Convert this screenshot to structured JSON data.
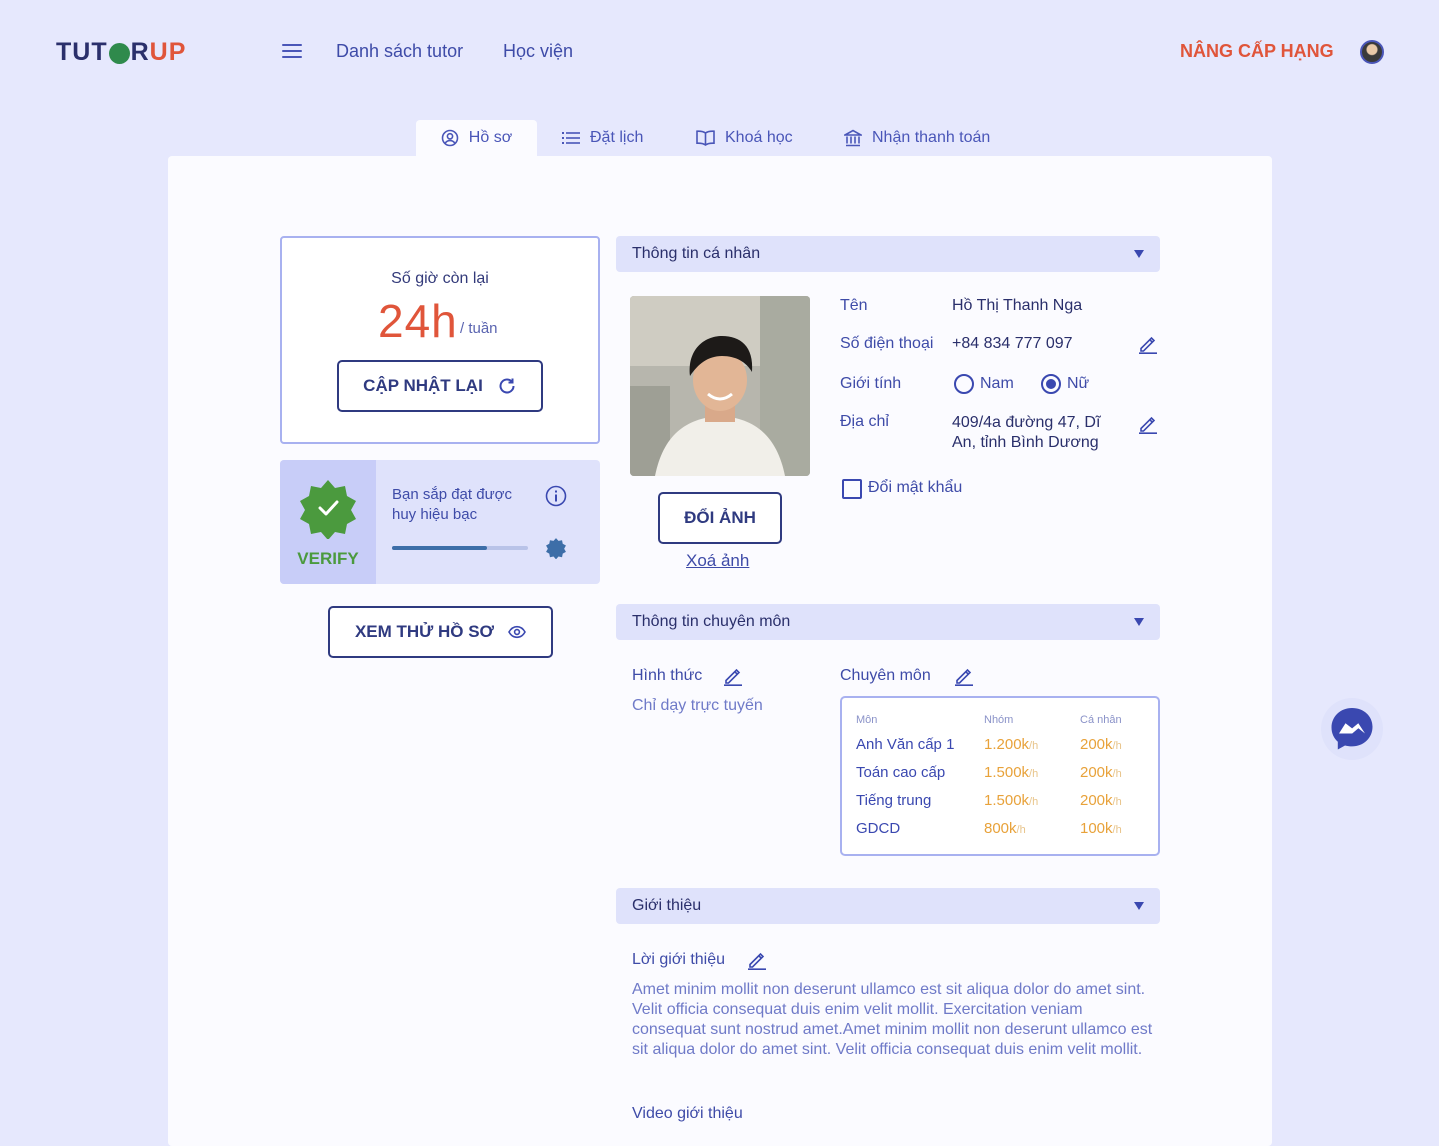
{
  "header": {
    "logo_part1": "TUT",
    "logo_part2": "R ",
    "logo_part3": "UP",
    "nav": [
      "Danh sách tutor",
      "Học viện"
    ],
    "upgrade": "NÂNG CẤP HẠNG"
  },
  "tabs": [
    {
      "label": "Hồ sơ",
      "icon": "user-circle-icon",
      "active": true
    },
    {
      "label": "Đặt lịch",
      "icon": "list-icon",
      "active": false
    },
    {
      "label": "Khoá học",
      "icon": "book-icon",
      "active": false
    },
    {
      "label": "Nhận thanh toán",
      "icon": "bank-icon",
      "active": false
    }
  ],
  "hours": {
    "title": "Số giờ còn lại",
    "value": "24h",
    "unit": "/ tuần",
    "refresh_label": "CẬP NHẬT LẠI"
  },
  "badge": {
    "verify": "VERIFY",
    "text": "Bạn sắp đạt được huy hiệu bạc",
    "progress": 0.7
  },
  "preview_label": "XEM THỬ HỒ SƠ",
  "personal": {
    "section_title": "Thông tin cá nhân",
    "change_photo": "ĐỔI ẢNH",
    "delete_photo": "Xoá ảnh",
    "name_label": "Tên",
    "name_value": "Hồ Thị Thanh Nga",
    "phone_label": "Số điện thoại",
    "phone_value": "+84 834 777 097",
    "gender_label": "Giới tính",
    "gender_options": [
      "Nam",
      "Nữ"
    ],
    "gender_selected": "Nữ",
    "address_label": "Địa chỉ",
    "address_value": "409/4a đường 47, Dĩ An, tỉnh Bình Dương",
    "change_password": "Đổi mật khẩu"
  },
  "professional": {
    "section_title": "Thông tin chuyên môn",
    "format_label": "Hình thức",
    "format_value": "Chỉ dạy trực tuyến",
    "subject_label": "Chuyên môn",
    "columns": [
      "Môn",
      "Nhóm",
      "Cá nhân"
    ],
    "unit": "/h",
    "rows": [
      {
        "subject": "Anh Văn cấp 1",
        "group": "1.200k",
        "personal": "200k"
      },
      {
        "subject": "Toán cao cấp",
        "group": "1.500k",
        "personal": "200k"
      },
      {
        "subject": "Tiếng trung",
        "group": "1.500k",
        "personal": "200k"
      },
      {
        "subject": "GDCD",
        "group": "800k",
        "personal": "100k"
      }
    ]
  },
  "intro": {
    "section_title": "Giới thiệu",
    "label": "Lời giới thiệu",
    "text": "Amet minim mollit non deserunt ullamco est sit aliqua dolor do amet sint. Velit officia consequat duis enim velit mollit. Exercitation veniam consequat sunt nostrud amet.Amet minim mollit non deserunt ullamco est sit aliqua dolor do amet sint. Velit officia consequat duis enim velit mollit.",
    "video_label": "Video giới thiệu"
  },
  "colors": {
    "background": "#e6e8fd",
    "accent": "#e0553a",
    "primary": "#3a48b0",
    "price": "#e8a23a",
    "verify": "#4b9a3e"
  }
}
